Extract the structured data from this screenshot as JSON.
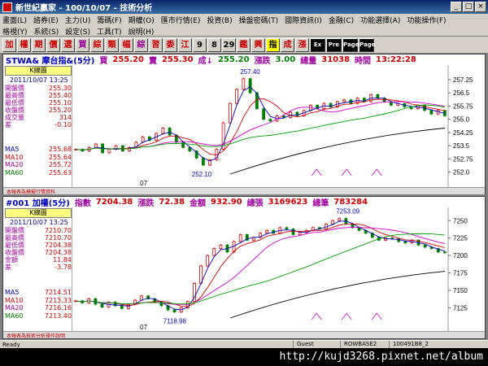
{
  "window": {
    "title": "新世紀贏家 - 100/10/07 - 技術分析",
    "close_label": "×",
    "min_label": "_",
    "max_label": "□"
  },
  "menu": {
    "row1": [
      "畫面(L)",
      "諮券(E)",
      "主力(U)",
      "籌碼(F)",
      "期權(O)",
      "匯市行情(E)",
      "投資(B)",
      "操盤密碼(T)",
      "國際資訊(I)",
      "金融(C)",
      "功能選擇(A)",
      "功能操作(F)"
    ],
    "row2": [
      "格視(Y)",
      "系統(S)",
      "設定(S)",
      "工具(T)",
      "說明(H)"
    ]
  },
  "toolbar": [
    "加",
    "權",
    "期",
    "價",
    "選",
    "買",
    "綜",
    "類",
    "幅",
    "綜",
    "習",
    "委",
    "江",
    "9",
    "8",
    "29",
    "鑑",
    "興",
    "指",
    "成",
    "漲",
    "Ex",
    "Pre",
    "Page",
    "Page"
  ],
  "top_panel": {
    "symbol": "STWA& 摩台指&(5分)",
    "buy_label": "買",
    "buy": "255.20",
    "sell_label": "賣",
    "sell": "255.30",
    "deal_label": "成↓",
    "deal": "255.20",
    "change_label": "漲跌",
    "change": "3.00",
    "vol_label": "總量",
    "vol": "31038",
    "time_label": "時間",
    "time": "13:22:28",
    "k_label": "K線圖",
    "date": "2011/10/07 13:25",
    "info": [
      {
        "k": "開盤價",
        "v": "255.30"
      },
      {
        "k": "最高價",
        "v": "255.40"
      },
      {
        "k": "最低價",
        "v": "255.10"
      },
      {
        "k": "收盤價",
        "v": "255.20"
      },
      {
        "k": "成交量",
        "v": "314"
      },
      {
        "k": "差",
        "v": "-0.10"
      }
    ],
    "ma": [
      {
        "k": "MA5",
        "v": "255.68",
        "color": "#0000c0"
      },
      {
        "k": "MA10",
        "v": "255.64",
        "color": "#d00000"
      },
      {
        "k": "MA20",
        "v": "255.72",
        "color": "#a000a0"
      },
      {
        "k": "MA60",
        "v": "255.63",
        "color": "#008000"
      }
    ],
    "yticks": [
      "257.25",
      "256.5",
      "255.75",
      "255.0",
      "254.25",
      "253.5",
      "252.75",
      "252.0"
    ],
    "hi_label": "257.40",
    "lo_label": "252.10",
    "xtick": "07",
    "footer": "本報表為模擬行情資料"
  },
  "bottom_panel": {
    "symbol": "#001 加權(5分)",
    "idx_label": "指數",
    "idx": "7204.38",
    "chg_label": "漲跌",
    "chg": "72.38",
    "amt_label": "金額",
    "amt": "932.90",
    "vol_label": "總張",
    "vol": "3169623",
    "cnt_label": "總筆",
    "cnt": "783284",
    "k_label": "K線圖",
    "date": "2011/10/07 13:25",
    "info": [
      {
        "k": "開盤價",
        "v": "7210.70"
      },
      {
        "k": "最高價",
        "v": "7210.70"
      },
      {
        "k": "最低價",
        "v": "7204.38"
      },
      {
        "k": "收盤價",
        "v": "7204.38"
      },
      {
        "k": "金額",
        "v": "11.84"
      },
      {
        "k": "差",
        "v": "-3.78"
      }
    ],
    "ma": [
      {
        "k": "MA5",
        "v": "7214.51",
        "color": "#0000c0"
      },
      {
        "k": "MA10",
        "v": "7213.33",
        "color": "#d00000"
      },
      {
        "k": "MA20",
        "v": "7216.16",
        "color": "#a000a0"
      },
      {
        "k": "MA60",
        "v": "7213.40",
        "color": "#008000"
      }
    ],
    "yticks": [
      "7250",
      "7225",
      "7200",
      "7175",
      "7150",
      "7125"
    ],
    "hi_label": "7253.09",
    "lo_label": "7118.98",
    "xtick": "07",
    "footer": "本報表為技術分析操作說明"
  },
  "status": {
    "ready": "Ready",
    "guest": "Guest",
    "base": "ROWBASE2",
    "code": "100491B8_2"
  },
  "watermark": "http://kujd3268.pixnet.net/album"
}
